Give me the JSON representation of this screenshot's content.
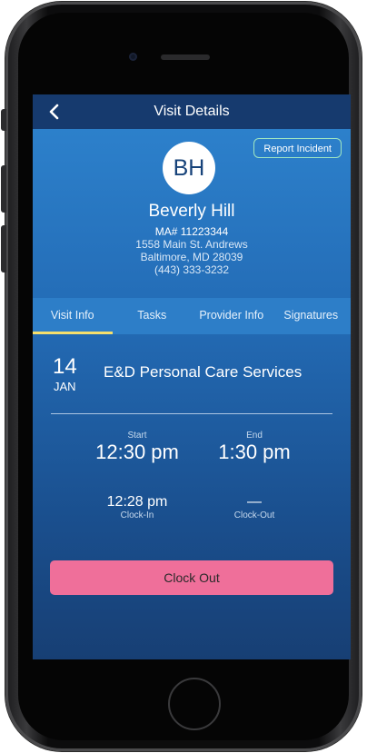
{
  "nav": {
    "title": "Visit Details"
  },
  "header": {
    "report_incident": "Report Incident",
    "avatar_initials": "BH",
    "client_name": "Beverly Hill",
    "ma_number": "MA# 11223344",
    "address_line1": "1558 Main St. Andrews",
    "address_line2": "Baltimore, MD 28039",
    "phone": "(443) 333-3232"
  },
  "tabs": [
    {
      "label": "Visit Info",
      "active": true
    },
    {
      "label": "Tasks",
      "active": false
    },
    {
      "label": "Provider Info",
      "active": false
    },
    {
      "label": "Signatures",
      "active": false
    }
  ],
  "visit": {
    "day": "14",
    "month": "JAN",
    "service": "E&D Personal Care Services",
    "start_label": "Start",
    "start_time": "12:30 pm",
    "end_label": "End",
    "end_time": "1:30 pm",
    "clock_in_time": "12:28 pm",
    "clock_in_label": "Clock-In",
    "clock_out_time": "—",
    "clock_out_label": "Clock-Out"
  },
  "actions": {
    "clock_out": "Clock Out"
  },
  "colors": {
    "nav_bg": "#163a6e",
    "tab_indicator": "#f6df6c",
    "clock_out_button": "#ef6f9a",
    "report_border": "#9ee6c2"
  },
  "icons": {
    "back": "chevron-left-icon"
  }
}
